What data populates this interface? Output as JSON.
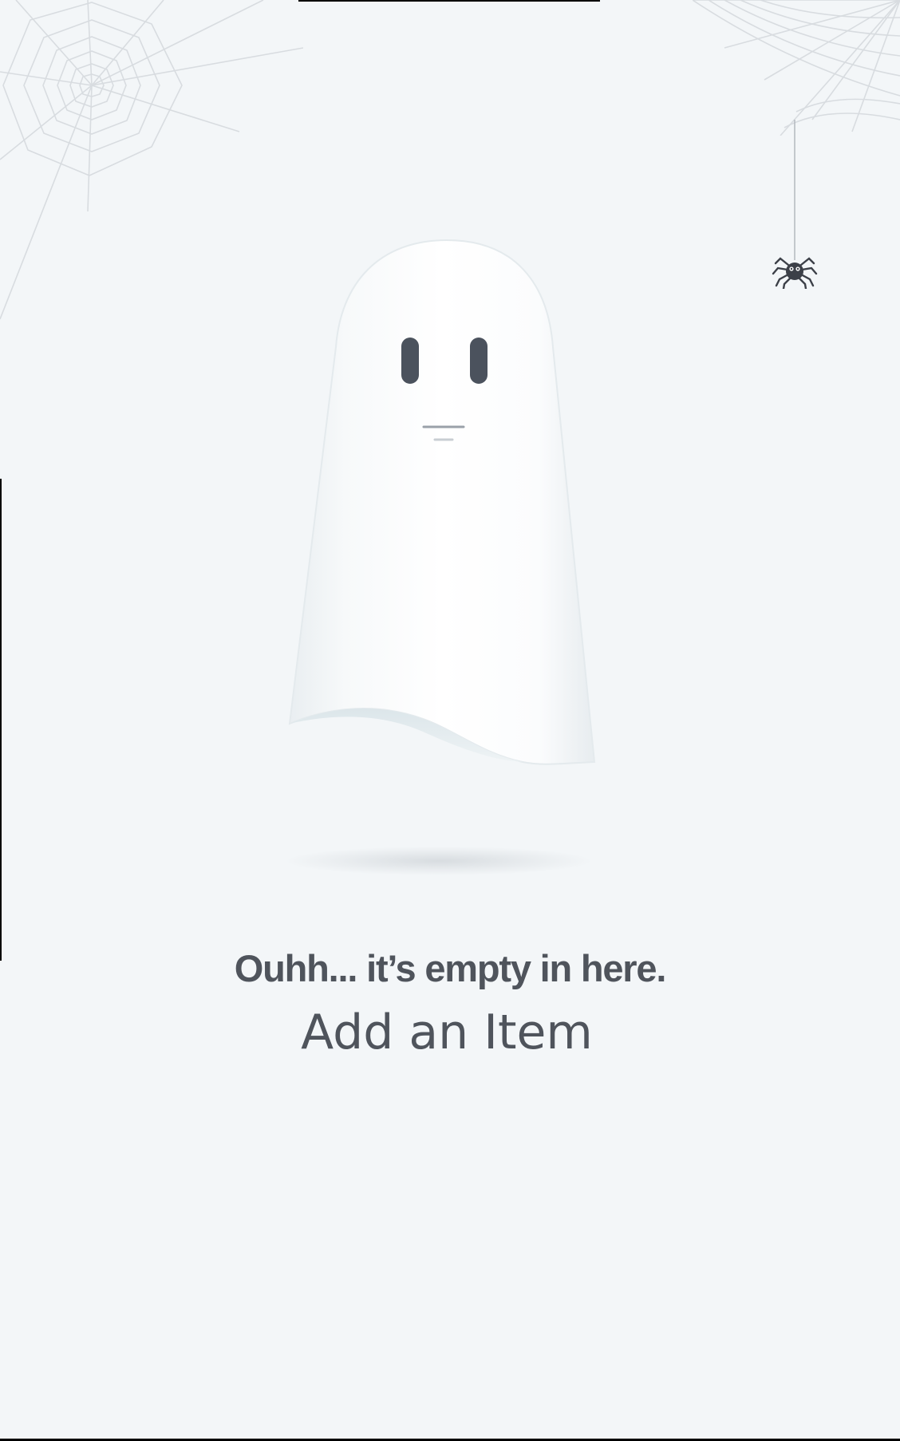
{
  "empty_state": {
    "message": "Ouhh... it’s empty in here.",
    "action_label": "Add an Item"
  },
  "illustration": {
    "character": "ghost",
    "decorations": [
      "cobweb-icon",
      "cobweb-icon",
      "spider-icon"
    ]
  },
  "colors": {
    "background": "#f3f6f8",
    "text": "#4f545c",
    "ghost_body": "#ffffff",
    "ghost_eyes": "#4b525d",
    "web_lines": "#d9dde1"
  }
}
